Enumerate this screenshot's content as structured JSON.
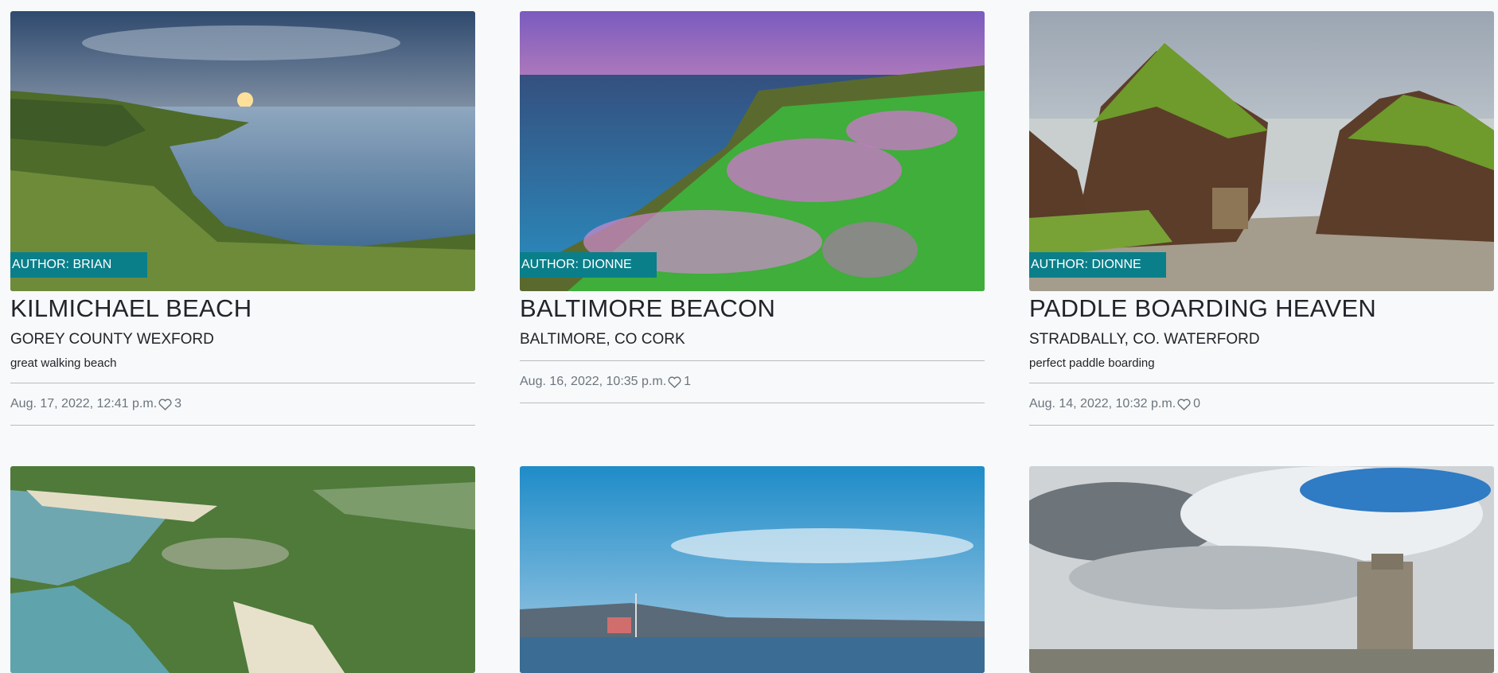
{
  "posts": [
    {
      "title": "KILMICHAEL BEACH",
      "location": "GOREY COUNTY WEXFORD",
      "excerpt": "great walking beach",
      "author": "AUTHOR: BRIAN",
      "date": "Aug. 17, 2022, 12:41 p.m.",
      "likes": "3",
      "image": "sunset-coast-image"
    },
    {
      "title": "BALTIMORE BEACON",
      "location": "BALTIMORE, CO CORK",
      "excerpt": "",
      "author": "AUTHOR: DIONNE",
      "date": "Aug. 16, 2022, 10:35 p.m.",
      "likes": "1",
      "image": "flowered-cliffs-image"
    },
    {
      "title": "PADDLE BOARDING HEAVEN",
      "location": "STRADBALLY, CO. WATERFORD",
      "excerpt": "perfect paddle boarding",
      "author": "AUTHOR: DIONNE",
      "date": "Aug. 14, 2022, 10:32 p.m.",
      "likes": "0",
      "image": "rock-cove-image"
    },
    {
      "image": "aerial-peninsula-image"
    },
    {
      "image": "harbour-town-image"
    },
    {
      "image": "castle-clouds-image"
    }
  ],
  "colors": {
    "author_badge": "#0a7f8a",
    "page_bg": "#f8f9fa"
  }
}
